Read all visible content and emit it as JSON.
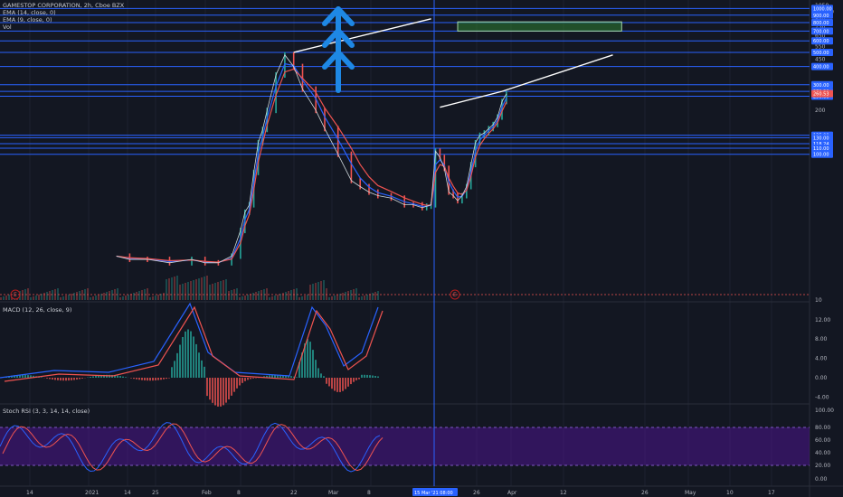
{
  "chart_data": {
    "type": "line",
    "title": "GAMESTOP CORPORATION, 2h, Cboe BZX",
    "indicators": [
      "EMA (14, close, 0)",
      "EMA (9, close, 0)",
      "Vol"
    ],
    "price_axis": {
      "scale": "log",
      "ylim": [
        10,
        1050
      ],
      "ticks": [
        10,
        20,
        50,
        100,
        150,
        200,
        250,
        300,
        350,
        400,
        450,
        500,
        550,
        600,
        650,
        700,
        750,
        800,
        850,
        900,
        950,
        1000,
        1050
      ],
      "tick_labels": [
        "10",
        "",
        "",
        "100",
        "",
        "200",
        "",
        "",
        "",
        "",
        "450",
        "",
        "550",
        "",
        "650",
        "",
        "750",
        "",
        "850",
        "",
        "950.00",
        "",
        "1050"
      ]
    },
    "horizontal_levels": [
      {
        "value": 1000,
        "label": "1000.00"
      },
      {
        "value": 900,
        "label": "900.00"
      },
      {
        "value": 800,
        "label": "800.00"
      },
      {
        "value": 700,
        "label": "700.00"
      },
      {
        "value": 600,
        "label": "600.00"
      },
      {
        "value": 500,
        "label": "500.00"
      },
      {
        "value": 400,
        "label": "400.00"
      },
      {
        "value": 300,
        "label": "300.00"
      },
      {
        "value": 270.2,
        "label": "270.20"
      },
      {
        "value": 250,
        "label": "250.00"
      },
      {
        "value": 135,
        "label": "135.00"
      },
      {
        "value": 130,
        "label": "130.00"
      },
      {
        "value": 118.24,
        "label": "118.24"
      },
      {
        "value": 110,
        "label": "110.00"
      },
      {
        "value": 100,
        "label": "100.00"
      }
    ],
    "current_price": "260.53",
    "x_ticks": [
      "14",
      "2021",
      "14",
      "25",
      "Feb",
      "8",
      "22",
      "Mar",
      "8",
      "15 Mar '21   08:00",
      "26",
      "Apr",
      "12",
      "26",
      "May",
      "10",
      "17"
    ],
    "close_series": {
      "name": "close",
      "x_days": [
        -17,
        -14,
        -10,
        -5,
        0,
        3,
        6,
        9,
        11,
        12,
        13,
        14,
        15,
        16,
        17,
        19,
        21,
        23,
        25,
        28,
        30,
        33,
        36,
        38,
        40,
        42,
        45,
        48,
        50,
        52,
        53,
        54,
        55,
        56,
        57,
        58,
        59,
        60,
        61,
        62,
        63,
        64,
        65,
        66,
        67,
        68,
        69,
        70,
        71
      ],
      "values": [
        20,
        19,
        19,
        18,
        19,
        18,
        18,
        20,
        30,
        40,
        45,
        75,
        120,
        148,
        200,
        350,
        480,
        400,
        280,
        200,
        150,
        100,
        66,
        60,
        55,
        52,
        50,
        45,
        45,
        43,
        44,
        45,
        105,
        95,
        80,
        55,
        52,
        48,
        52,
        60,
        85,
        120,
        135,
        140,
        150,
        160,
        180,
        230,
        260
      ]
    },
    "annotations": {
      "trend_lines": [
        {
          "from": [
            23,
            500
          ],
          "to": [
            54,
            850
          ]
        },
        {
          "from": [
            56,
            210
          ],
          "to": [
            70,
            270
          ]
        },
        {
          "from": [
            70,
            270
          ],
          "to": [
            95,
            480
          ]
        }
      ],
      "box": {
        "x_from": [
          60,
          97
        ],
        "price_from": [
          700,
          810
        ]
      },
      "arrows": "up"
    },
    "macd": {
      "title": "MACD (12, 26, close, 9)",
      "ticks": [
        "12.00",
        "8.00",
        "4.00",
        "0.00",
        "-4.00"
      ],
      "ylim": [
        -4.5,
        14.5
      ]
    },
    "stoch_rsi": {
      "title": "Stoch RSI (3, 3, 14, 14, close)",
      "ticks": [
        "100.00",
        "80.00",
        "60.00",
        "40.00",
        "20.00",
        "0.00"
      ],
      "bands": [
        20,
        80
      ],
      "ylim": [
        0,
        100
      ]
    },
    "colors": {
      "background": "#131722",
      "level_line": "#2962ff",
      "candle_up": "#26a69a",
      "candle_down": "#ef5350",
      "ema_fast": "#2962ff",
      "ema_slow": "#ef5350",
      "trend_line": "#ffffff",
      "box_fill": "#2e7d32",
      "arrow": "#1e88e5",
      "stoch_band": "#4a148c",
      "crosshair": "#2962ff"
    },
    "grid": true,
    "earnings_markers": [
      "E",
      "E"
    ]
  }
}
